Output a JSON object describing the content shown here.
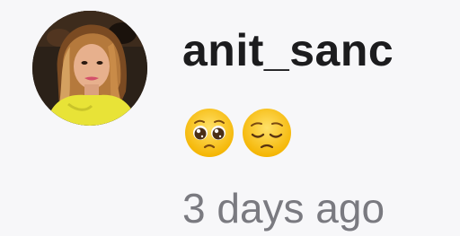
{
  "comment": {
    "username": "anit_sanc",
    "text": "🥺😔",
    "timestamp": "3 days ago"
  },
  "icons": {
    "avatar": "profile-photo",
    "emoji_1": "pleading-face-emoji",
    "emoji_2": "pensive-face-emoji"
  }
}
